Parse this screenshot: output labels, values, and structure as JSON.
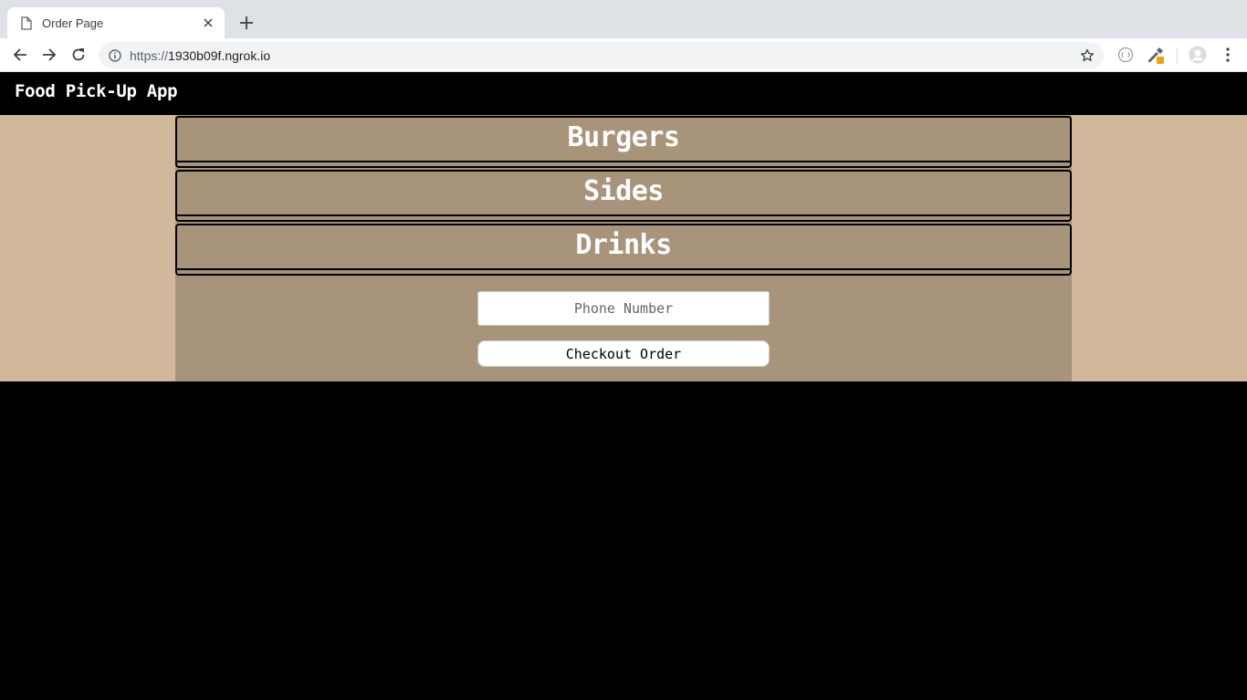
{
  "browser": {
    "tab": {
      "title": "Order Page"
    },
    "address_bar": {
      "scheme": "https://",
      "host": "1930b09f.ngrok.io"
    }
  },
  "app": {
    "title": "Food Pick-Up App"
  },
  "menu": {
    "categories": [
      {
        "label": "Burgers"
      },
      {
        "label": "Sides"
      },
      {
        "label": "Drinks"
      }
    ]
  },
  "order_form": {
    "phone_placeholder": "Phone Number",
    "phone_value": "",
    "checkout_label": "Checkout Order"
  },
  "colors": {
    "page_background": "#d2b89a",
    "panel_background": "#a7947b",
    "header_background": "#000000"
  }
}
